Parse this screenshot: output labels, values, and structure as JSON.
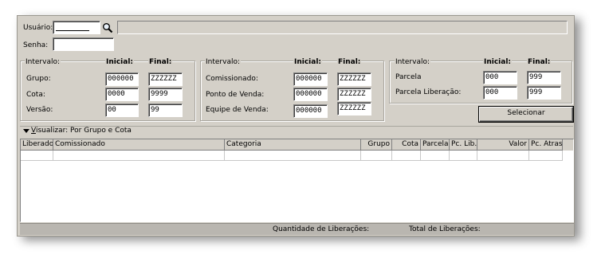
{
  "login": {
    "usuario_label": "Usuário:",
    "usuario_value": "",
    "senha_label": "Senha:",
    "senha_value": ""
  },
  "intervals": {
    "left": {
      "header": "Intervalo:",
      "inicial_label": "Inicial:",
      "final_label": "Final:",
      "rows": [
        {
          "label": "Grupo:",
          "inicial": "000000",
          "final": "ZZZZZZ"
        },
        {
          "label": "Cota:",
          "inicial": "0000",
          "final": "9999"
        },
        {
          "label": "Versão:",
          "inicial": "00",
          "final": "99"
        }
      ]
    },
    "middle": {
      "header": "Intervalo:",
      "inicial_label": "Inicial:",
      "final_label": "Final:",
      "rows": [
        {
          "label": "Comissionado:",
          "inicial": "000000",
          "final": "ZZZZZZ"
        },
        {
          "label": "Ponto de Venda:",
          "inicial": "000000",
          "final": "ZZZZZZ"
        },
        {
          "label": "Equipe de Venda:",
          "inicial": "000000",
          "final": "ZZZZZZ"
        }
      ]
    },
    "right": {
      "header": "Intervalo:",
      "inicial_label": "Inicial:",
      "final_label": "Final:",
      "rows": [
        {
          "label": "Parcela",
          "inicial": "000",
          "final": "999"
        },
        {
          "label": "Parcela Liberação:",
          "inicial": "000",
          "final": "999"
        }
      ]
    }
  },
  "actions": {
    "select_label": "Selecionar"
  },
  "view": {
    "toggle_icon": "triangle-down-icon",
    "label_prefix": "V",
    "label_rest": "isualizar: Por Grupo e Cota"
  },
  "table": {
    "columns": [
      "Liberado",
      "Comissionado",
      "Categoria",
      "Grupo",
      "Cota",
      "Parcela",
      "Pc. Lib.",
      "Valor",
      "Pc. Atras."
    ]
  },
  "status": {
    "quantidade_label": "Quantidade de Liberações:",
    "total_label": "Total de Liberações:"
  }
}
